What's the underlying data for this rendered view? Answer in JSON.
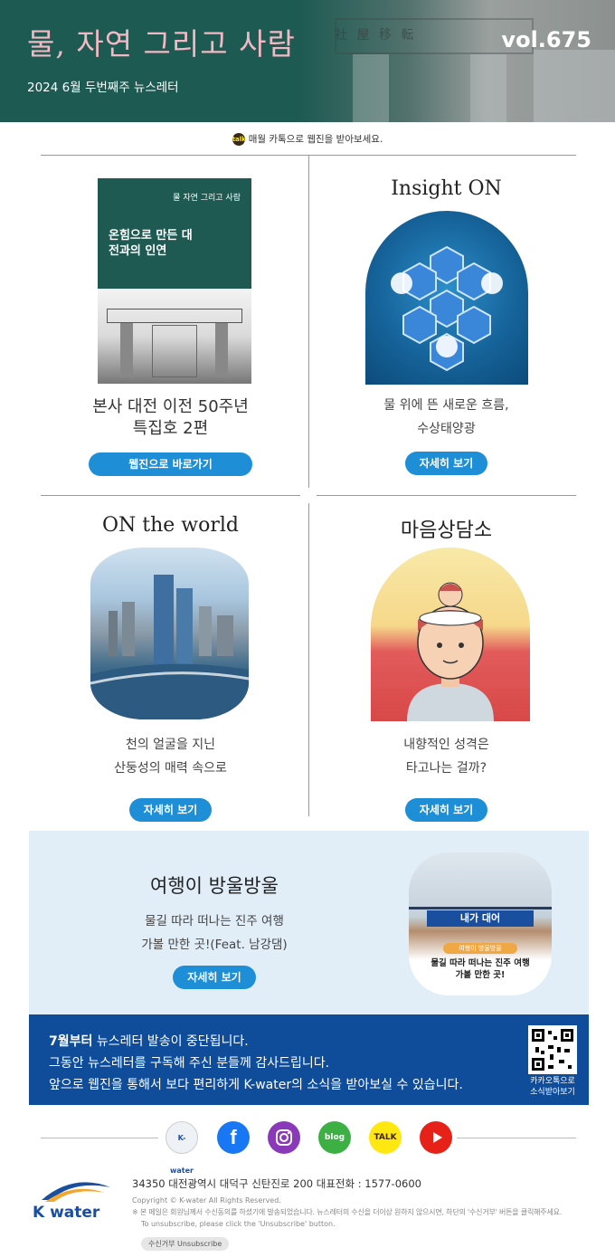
{
  "header": {
    "title": "물, 자연 그리고 사람",
    "subtitle": "2024 6월 두번째주 뉴스레터",
    "volume": "vol.675"
  },
  "kakao_notice": "매월 카톡으로 웹진을 받아보세요.",
  "cards": {
    "webzine": {
      "cover_title": "물 자연 그리고 사람",
      "cover_headline": "온힘으로 만든 대전과의 인연",
      "title_line1": "본사 대전 이전 50주년",
      "title_line2": "특집호 2편",
      "button": "웹진으로 바로가기"
    },
    "insight": {
      "heading": "Insight ON",
      "desc_line1": "물 위에 뜬 새로운 흐름,",
      "desc_line2": "수상태양광",
      "button": "자세히 보기"
    },
    "world": {
      "heading": "ON the world",
      "desc_line1": "천의 얼굴을 지닌",
      "desc_line2": "산둥성의 매력 속으로",
      "button": "자세히 보기"
    },
    "counsel": {
      "heading": "마음상담소",
      "desc_line1": "내향적인 성격은",
      "desc_line2": "타고나는 걸까?",
      "button": "자세히 보기"
    }
  },
  "travel": {
    "heading": "여행이 방울방울",
    "desc_line1": "물길 따라 떠나는 진주 여행",
    "desc_line2": "가볼 만한 곳!(Feat. 남강댐)",
    "button": "자세히 보기",
    "image_sign": "내가 대어",
    "image_tag": "여행이 방울방울",
    "image_caption1": "물길 따라 떠나는 진주 여행",
    "image_caption2": "가볼 만한 곳!"
  },
  "notice": {
    "line1_bold": "7월부터",
    "line1_rest": " 뉴스레터 발송이 중단됩니다.",
    "line2": "그동안 뉴스레터를 구독해 주신 분들께 감사드립니다.",
    "line3": "앞으로 웹진을 통해서 보다 편리하게 K-water의 소식을 받아보실 수 있습니다.",
    "qr_label1": "카카오톡으로",
    "qr_label2": "소식받아보기"
  },
  "social": {
    "kwater": "K-water",
    "blog": "blog",
    "talk": "TALK"
  },
  "footer": {
    "logo": "K water",
    "address": "34350 대전광역시 대덕구 신탄진로 200  대표전화 : 1577-0600",
    "copyright": "Copyright © K-water All Rights Reserved.",
    "disclaimer": "※ 본 메일은 회원님께서 수신동의를 하셨기에 발송되었습니다. 뉴스레터의 수신을 더이상 원하지 않으시면, 하단의 '수신거부' 버튼을 클릭해주세요.",
    "disclaimer_en": "To unsubscribe, please click the 'Unsubscribe' button.",
    "unsubscribe": "수신거부  Unsubscribe"
  },
  "colors": {
    "header_bg": "#1d5a52",
    "title_pink": "#f2b9c4",
    "button_blue": "#1e8fd6",
    "notice_bg": "#0f4c9a",
    "travel_bg": "#e1eef8"
  }
}
